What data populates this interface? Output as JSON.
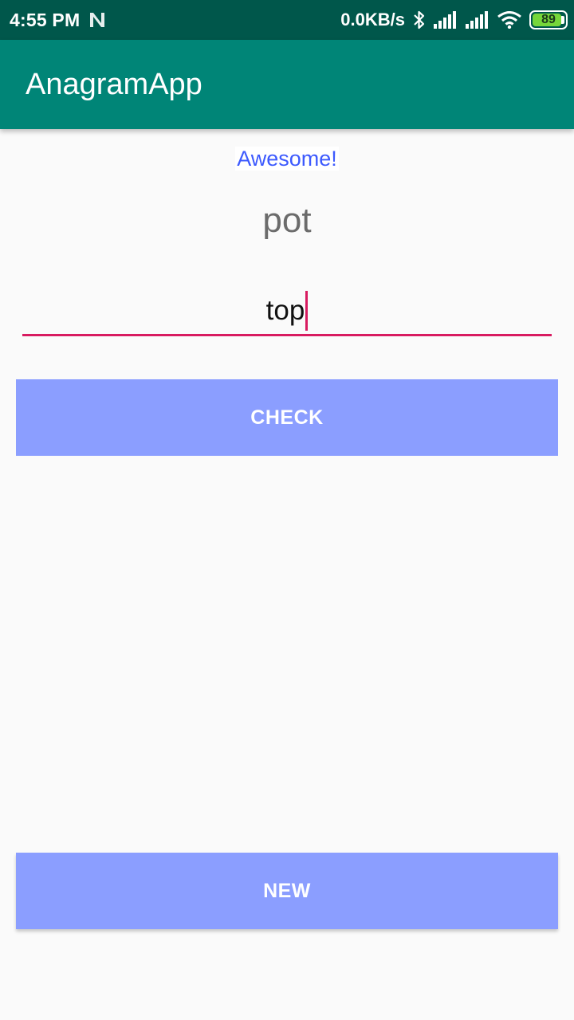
{
  "status_bar": {
    "time": "4:55 PM",
    "network_speed": "0.0KB/s",
    "battery_level": "89",
    "battery_fill_fraction": 0.89,
    "battery_color": "#76d63a",
    "icons": [
      "n-icon",
      "bluetooth-icon",
      "signal-icon",
      "signal-icon",
      "wifi-icon",
      "battery-icon"
    ]
  },
  "app_bar": {
    "title": "AnagramApp",
    "color": "#008577"
  },
  "main": {
    "result_message": "Awesome!",
    "scrambled_word": "pot",
    "answer_input": {
      "value": "top",
      "underline_color": "#d81b60"
    },
    "check_button_label": "CHECK",
    "new_button_label": "NEW",
    "button_color": "#8b9eff"
  }
}
